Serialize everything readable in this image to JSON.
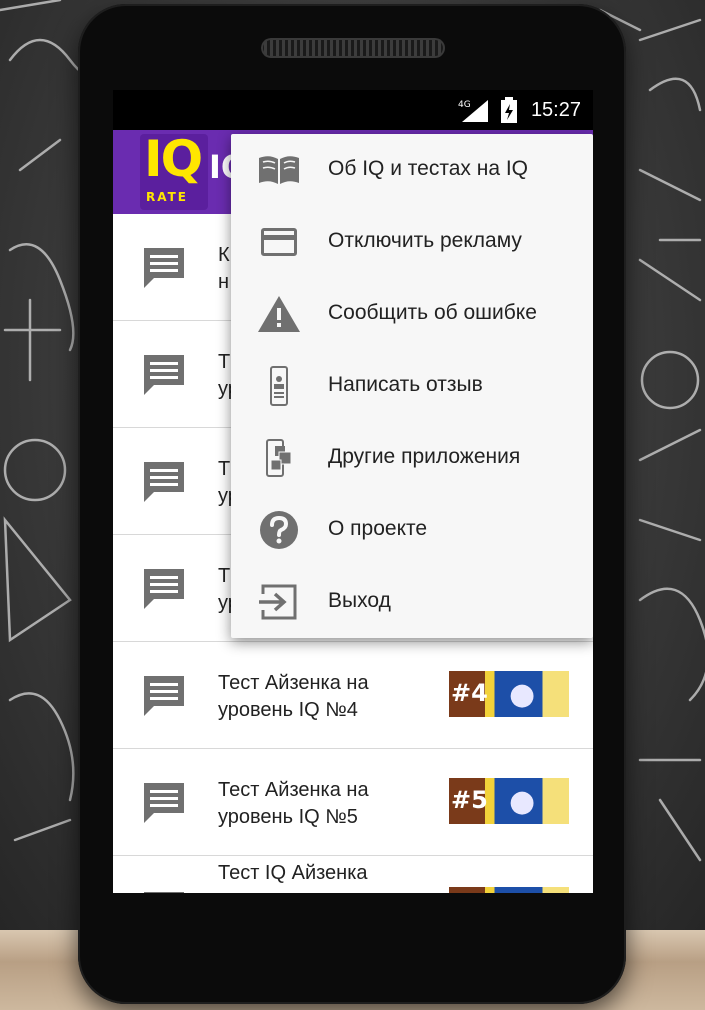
{
  "status_bar": {
    "network": "4G",
    "time": "15:27"
  },
  "app_bar": {
    "logo_main": "IQ",
    "logo_sub": "RATE",
    "title": "IQ"
  },
  "list": [
    {
      "text": "К\nн",
      "thumb": ""
    },
    {
      "text": "Т\nур",
      "thumb": ""
    },
    {
      "text": "Т\nур",
      "thumb": ""
    },
    {
      "text": "Т\nур",
      "thumb": ""
    },
    {
      "text": "Тест Айзенка на\nуровень IQ №4",
      "thumb": "#4"
    },
    {
      "text": "Тест Айзенка на\nуровень IQ №5",
      "thumb": "#5"
    },
    {
      "text": "Тест IQ Айзенка",
      "thumb": ""
    }
  ],
  "menu": {
    "items": [
      {
        "label": "Об IQ и тестах на IQ",
        "icon": "book-icon"
      },
      {
        "label": "Отключить рекламу",
        "icon": "credit-card-icon"
      },
      {
        "label": "Сообщить об ошибке",
        "icon": "warning-icon"
      },
      {
        "label": "Написать отзыв",
        "icon": "phone-review-icon"
      },
      {
        "label": "Другие приложения",
        "icon": "other-apps-icon"
      },
      {
        "label": "О проекте",
        "icon": "help-icon"
      },
      {
        "label": "Выход",
        "icon": "exit-icon"
      }
    ]
  },
  "colors": {
    "app_bar": "#6a2cb0",
    "logo_yellow": "#ffe600",
    "icon_gray": "#707070"
  }
}
